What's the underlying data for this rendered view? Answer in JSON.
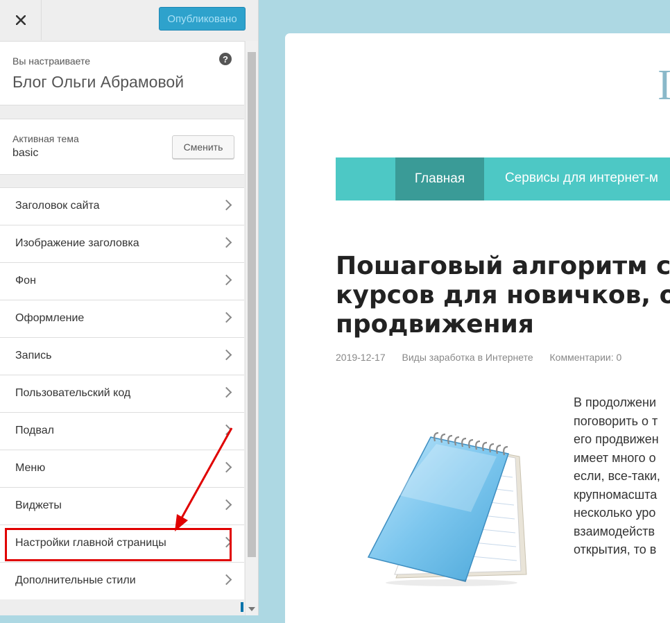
{
  "header": {
    "close_icon": "close-icon",
    "publish_label": "Опубликовано"
  },
  "site_info": {
    "label": "Вы настраиваете",
    "title": "Блог Ольги Абрамовой",
    "help_icon": "question-icon",
    "help_glyph": "?"
  },
  "theme": {
    "label": "Активная тема",
    "name": "basic",
    "change_label": "Сменить"
  },
  "menu": {
    "items": [
      {
        "label": "Заголовок сайта"
      },
      {
        "label": "Изображение заголовка"
      },
      {
        "label": "Фон"
      },
      {
        "label": "Оформление"
      },
      {
        "label": "Запись"
      },
      {
        "label": "Пользовательский код"
      },
      {
        "label": "Подвал"
      },
      {
        "label": "Меню"
      },
      {
        "label": "Виджеты"
      },
      {
        "label": "Настройки главной страницы",
        "highlighted": true
      },
      {
        "label": "Дополнительные стили"
      }
    ]
  },
  "annotation": {
    "color": "#e00000"
  },
  "preview": {
    "logo_fragment": "I",
    "nav": {
      "home": "Главная",
      "services": "Сервисы для интернет-м"
    },
    "post": {
      "title_lines": [
        "Пошаговый алгоритм со",
        "курсов для новичков, ос",
        "продвижения"
      ],
      "date": "2019-12-17",
      "category": "Виды заработка в Интернете",
      "comments": "Комментарии: 0",
      "excerpt_lines": [
        "В продолжени",
        "поговорить о т",
        "его продвижен",
        "имеет много о",
        "если, все-таки,",
        "крупномасшта",
        "несколько уро",
        "взаимодейств",
        "открытия, то в"
      ],
      "image_icon": "notepad-icon"
    }
  },
  "colors": {
    "publish_bg": "#2ea2cc",
    "nav_bg": "#4dc8c5",
    "nav_active_bg": "#3a9b97",
    "background": "#add8e3"
  }
}
